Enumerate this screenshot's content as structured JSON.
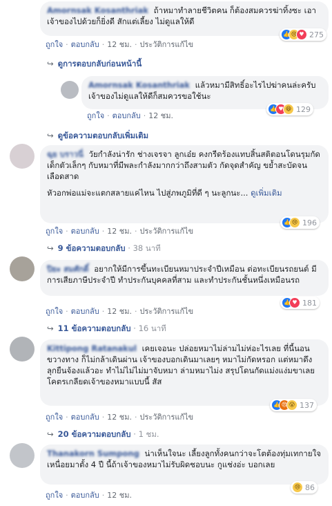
{
  "actions": {
    "like": "ถูกใจ",
    "reply": "ตอบกลับ",
    "edit": "ประวัติการแก้ไข"
  },
  "comments": [
    {
      "name": "Amornsak Kosanthriak",
      "text": "ถ้าหมาทำลายชีวิตคน ก็ต้องสมควรฆ่าทิ้งซะ เอาเจ้าของไปด้วยก็ยิ่งดี สักแต่เลี้ยง ไม่ดูแลให้ดี",
      "time": "12 ชม.",
      "reactions": [
        "like",
        "sad",
        "love"
      ],
      "count": "275",
      "show_previous": "ดูการตอบกลับก่อนหน้านี้"
    },
    {
      "name": "Amornsak Kosanthriak",
      "text": "แล้วหมามีสิทธิ์อะไรไปฆ่าคนล่ะครับ เจ้าของไม่ดูแลให้ดีก็สมควรขอใช้นะ",
      "time": "12 ชม.",
      "reactions": [
        "like",
        "love",
        "haha"
      ],
      "count": "129",
      "more_replies": "ดูข้อความตอบกลับเพิ่มเติม"
    },
    {
      "name": "ฉุย บราวนี่",
      "text": "วัยกำลังน่ารัก ช่างเจรจา ลูกเอ๋ย คงกรีดร้องแทบสิ้นสติตอนโดนรุมกัด เด็กตัวเล็กๆ กับหมาที่มีพละกำลังมากกว่าถึงสามตัว กัดจุดสำคัญ ขย้ำสะบัดจนเลือดสาด",
      "text2": "หัวอกพ่อแม่จะแตกสลายแค่ไหน ไปสู่ภพภูมิที่ดี ๆ นะลูกนะ...",
      "see_more": "ดูเพิ่มเติม",
      "time": "12 ชม.",
      "reactions": [
        "like",
        "sad"
      ],
      "count": "196",
      "replies": "9 ข้อความตอบกลับ",
      "reply_time": "38 นาที"
    },
    {
      "name": "ปิยะ สมศักดิ์",
      "text": "อยากให้มีการขึ้นทะเบียนหมาประจำปีเหมือน ต่อทะเบียนรถยนต์ มีการเสียภาษีประจำปี ทำประกันบุคคลที่สาม และทำประกันชั้นหนึ่งเหมือนรถ",
      "time": "12 ชม.",
      "reactions": [
        "like",
        "love"
      ],
      "count": "181",
      "replies": "11 ข้อความตอบกลับ",
      "reply_time": "16 นาที"
    },
    {
      "name": "Kittipong Ratanakul",
      "text": "เคยเจอนะ ปล่อยหมาไม่ล่ามไม่ห่อะไรเลย ที่นี้นอนขวางทาง ก็ไม่กล้าเดินผ่าน เจ้าของบอกเดินมาเลยๆ หมาไม่กัดหรอก แต่หมาดึงลุกยืนจ้องแล้วอะ ทำไม่ไม่ไม่มาจับหมา ล่ามหมาไม่ง สรุปโดนกัดแม่งแง่มขาเลย โคตรเกลียดเจ้าของหมาแบบนี้ สัส",
      "time": "12 ชม.",
      "reactions": [
        "like",
        "angry",
        "wow"
      ],
      "count": "137",
      "replies": "20 ข้อความตอบกลับ",
      "reply_time": "1 ชม."
    },
    {
      "name": "Thanakorn Sumpong",
      "text": "น่าเห็นใจนะ เลี้ยงลูกทั้งคนกว่าจะโตต้องทุ่มเทกายใจ เหนื่อยมาตั้ง 4 ปี นี้ถ้าเจ้าของหมาไม่รับผิดชอบนะ กูแช่งอ่ะ บอกเลย",
      "time": "12 ชม.",
      "reactions": [
        "sad"
      ],
      "count": "86"
    }
  ]
}
